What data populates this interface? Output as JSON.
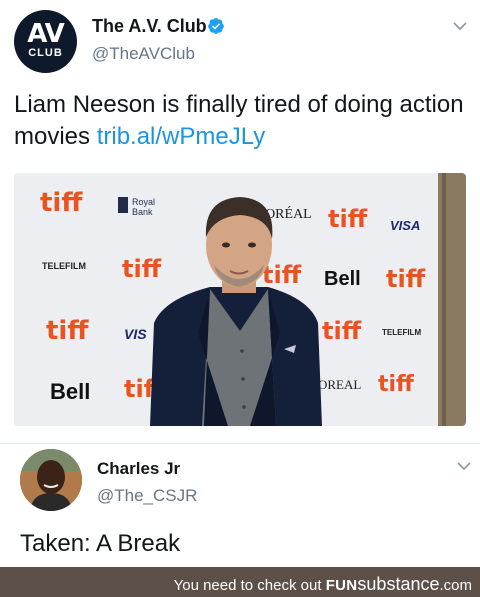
{
  "tweet1": {
    "avatar_line1": "AV",
    "avatar_line2": "CLUB",
    "author_name": "The A.V. Club",
    "author_handle": "@TheAVClub",
    "text": "Liam Neeson is finally tired of doing action movies",
    "link_text": "trib.al/wPmeJLy",
    "photo_backdrop_logos": [
      "tiff",
      "Royal Bank",
      "L'ORÉAL",
      "VISA",
      "TELEFILM CANADA",
      "Bell"
    ]
  },
  "tweet2": {
    "author_name": "Charles Jr",
    "author_handle": "@The_CSJR",
    "text": "Taken: A Break"
  },
  "footer": {
    "prefix": "You need to check out ",
    "brand_bold": "FUN",
    "brand_rest": "substance",
    "brand_suffix": ".com"
  },
  "colors": {
    "link": "#1b95e0",
    "verified": "#1da1f2",
    "tiff_orange": "#e8531f",
    "footer_bg": "#5d5049"
  }
}
